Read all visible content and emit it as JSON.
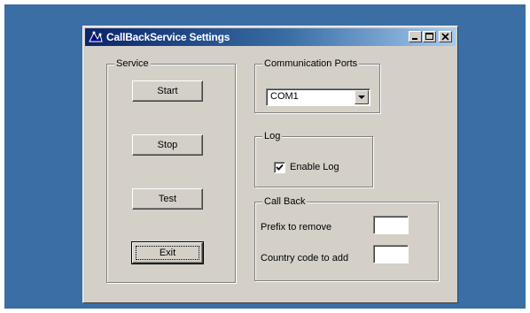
{
  "window": {
    "title": "CallBackService Settings",
    "icons": {
      "app": "callback-app-icon",
      "minimize": "minimize-icon",
      "maximize": "maximize-icon",
      "close": "close-icon"
    }
  },
  "service": {
    "label": "Service",
    "start_label": "Start",
    "stop_label": "Stop",
    "test_label": "Test",
    "exit_label": "Exit"
  },
  "ports": {
    "label": "Communication Ports",
    "selected": "COM1"
  },
  "log": {
    "label": "Log",
    "enable_label": "Enable Log",
    "enabled": true
  },
  "callback": {
    "label": "Call Back",
    "prefix_label": "Prefix to remove",
    "prefix_value": "",
    "country_label": "Country code to add",
    "country_value": ""
  },
  "colors": {
    "desktop": "#3a6ea5",
    "titlebar_start": "#0a246a",
    "titlebar_end": "#a6caf0",
    "face": "#d4d0c8"
  }
}
